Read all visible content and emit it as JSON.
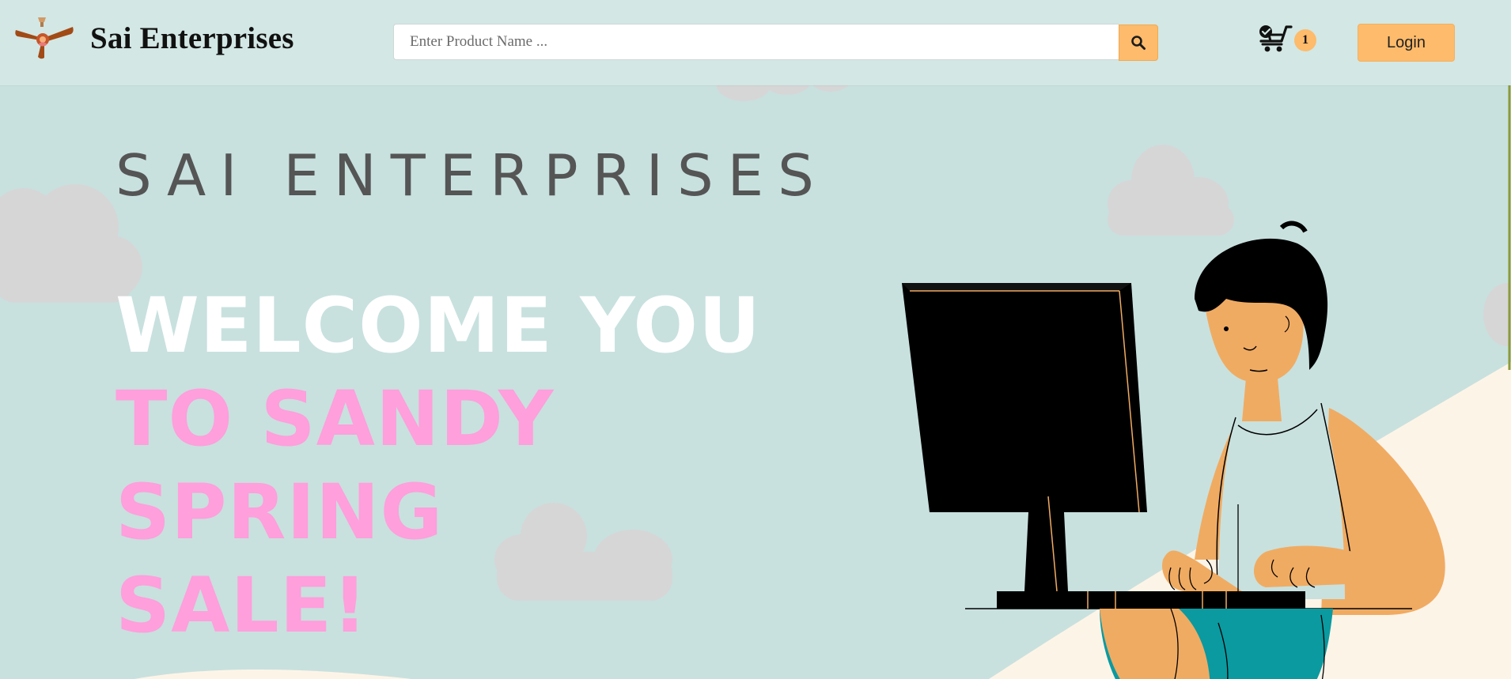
{
  "header": {
    "brand_name": "Sai Enterprises",
    "logo_icon": "ceiling-fan-icon",
    "search": {
      "placeholder": "Enter Product Name ...",
      "value": "",
      "button_icon": "search-icon"
    },
    "cart": {
      "icon": "shopping-cart-icon",
      "count": "1"
    },
    "login_label": "Login"
  },
  "hero": {
    "subtitle": "SAI ENTERPRISES",
    "headline_line1": "WELCOME YOU",
    "headline_line2": "TO SANDY SPRING",
    "headline_line3": "SALE!",
    "illustration": "person-typing-at-computer-illustration"
  },
  "colors": {
    "background": "#c8e1de",
    "navbar": "#d3e7e4",
    "accent": "#fdbb6b",
    "headline_white": "#ffffff",
    "headline_pink": "#ff9fdc",
    "cloud": "#d6d6d6",
    "sand": "#fdf4e8",
    "skin": "#f0ab62",
    "shorts": "#0a9aa0"
  }
}
